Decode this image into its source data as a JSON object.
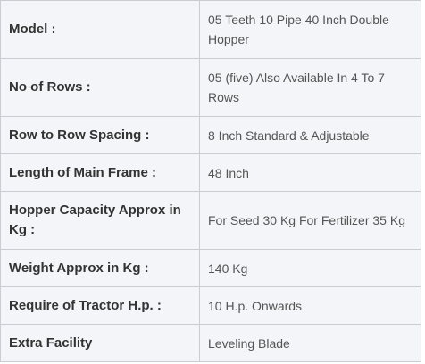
{
  "rows": [
    {
      "label": "Model :",
      "value": "05 Teeth 10 Pipe 40 Inch Double Hopper"
    },
    {
      "label": "No of Rows :",
      "value": "05 (five) Also Available In 4 To 7 Rows"
    },
    {
      "label": "Row to Row Spacing :",
      "value": "8 Inch Standard & Adjustable"
    },
    {
      "label": "Length of Main Frame :",
      "value": "48 Inch"
    },
    {
      "label": "Hopper Capacity Approx in Kg :",
      "value": "For Seed 30 Kg For Fertilizer 35 Kg"
    },
    {
      "label": "Weight Approx in Kg :",
      "value": "140 Kg"
    },
    {
      "label": "Require of Tractor H.p. :",
      "value": "10 H.p. Onwards"
    },
    {
      "label": "Extra Facility",
      "value": "Leveling Blade"
    }
  ]
}
